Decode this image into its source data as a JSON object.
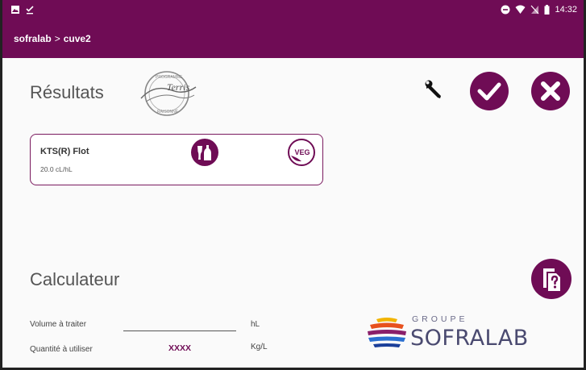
{
  "status_bar": {
    "time": "14:32"
  },
  "app_bar": {
    "crumb_root": "sofralab",
    "separator": ">",
    "crumb_current": "cuve2"
  },
  "results": {
    "title": "Résultats",
    "logo_text": {
      "ring_top": "PROGRAMME",
      "ring_bottom": "RAISONNÉ",
      "script": "Terris"
    },
    "product": {
      "name": "KTS(R) Flot",
      "dose": "20.0 cL/hL",
      "badge": "VEG"
    }
  },
  "icons": {
    "settings": "wrench-icon",
    "confirm": "check-circle-icon",
    "cancel": "close-circle-icon",
    "allergen": "glass-bottle-icon",
    "vegan": "vegan-icon",
    "help": "help-document-icon"
  },
  "calculator": {
    "title": "Calculateur",
    "volume_label": "Volume à traiter",
    "volume_value": "",
    "volume_unit": "hL",
    "quantity_label": "Quantité à utiliser",
    "quantity_value": "XXXX",
    "quantity_unit": "Kg/L"
  },
  "brand": {
    "groupe": "GROUPE",
    "name": "SOFRALAB"
  },
  "colors": {
    "primary": "#6f0c55",
    "card_border": "#7a1a5e",
    "text": "#555555"
  }
}
